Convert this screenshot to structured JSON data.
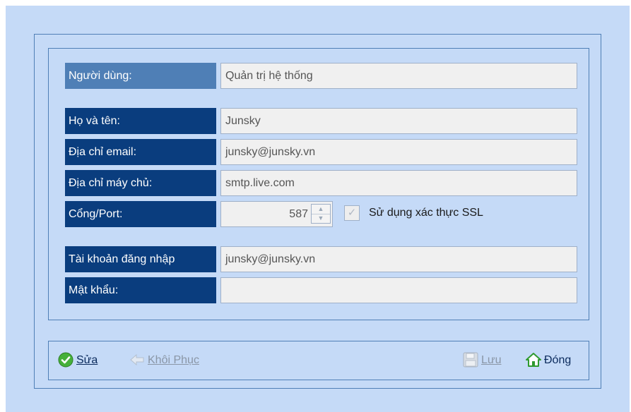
{
  "form": {
    "user": {
      "label": "Người dùng:",
      "value": "Quản trị hệ thống"
    },
    "fullname": {
      "label": "Họ và tên:",
      "value": "Junsky"
    },
    "email": {
      "label": "Địa chỉ email:",
      "value": "junsky@junsky.vn"
    },
    "server": {
      "label": "Địa chỉ máy chủ:",
      "value": "smtp.live.com"
    },
    "port": {
      "label": "Cổng/Port:",
      "value": "587"
    },
    "ssl": {
      "label": "Sử dụng xác thực SSL",
      "checked": true
    },
    "account": {
      "label": "Tài khoản đăng nhập",
      "value": "junsky@junsky.vn"
    },
    "password": {
      "label": "Mật khẩu:",
      "value": ""
    }
  },
  "toolbar": {
    "edit": {
      "label": "Sửa",
      "icon": "check-circle-icon"
    },
    "restore": {
      "label": "Khôi Phục",
      "icon": "arrow-left-icon"
    },
    "save": {
      "label": "Lưu",
      "icon": "floppy-icon"
    },
    "close": {
      "label": "Đóng",
      "icon": "home-icon"
    }
  },
  "colors": {
    "background": "#c5daf7",
    "label_dark": "#0a3d7e",
    "label_light": "#4f7fb6",
    "field_bg": "#f0f0f0"
  }
}
